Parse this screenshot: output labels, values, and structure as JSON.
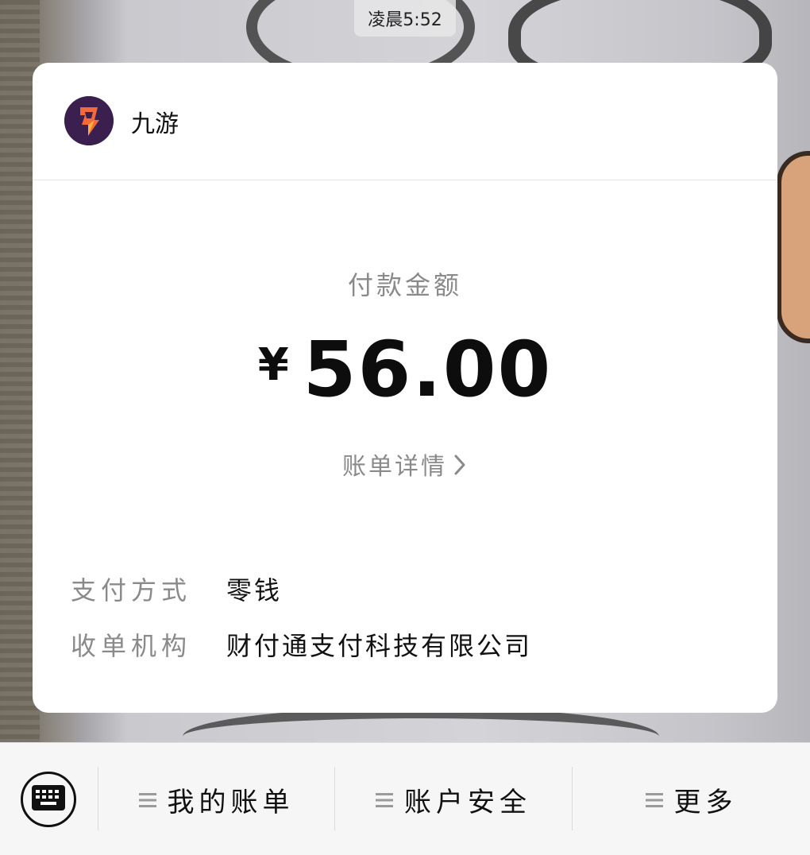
{
  "status": {
    "time": "凌晨5:52"
  },
  "merchant": {
    "name": "九游",
    "logo_icon": "jiuyou-logo-icon"
  },
  "payment": {
    "amount_label": "付款金额",
    "currency_symbol": "¥",
    "amount": "56.00",
    "detail_link": "账单详情"
  },
  "info": {
    "method_label": "支付方式",
    "method_value": "零钱",
    "institution_label": "收单机构",
    "institution_value": "财付通支付科技有限公司"
  },
  "bottom_menu": {
    "keyboard_icon": "keyboard-icon",
    "items": [
      {
        "label": "我的账单",
        "icon": "menu-icon"
      },
      {
        "label": "账户安全",
        "icon": "menu-icon"
      },
      {
        "label": "更多",
        "icon": "menu-icon"
      }
    ]
  },
  "colors": {
    "card_bg": "#ffffff",
    "muted_text": "#8a8a8a",
    "primary_text": "#111111",
    "bar_bg": "#f6f6f6"
  }
}
